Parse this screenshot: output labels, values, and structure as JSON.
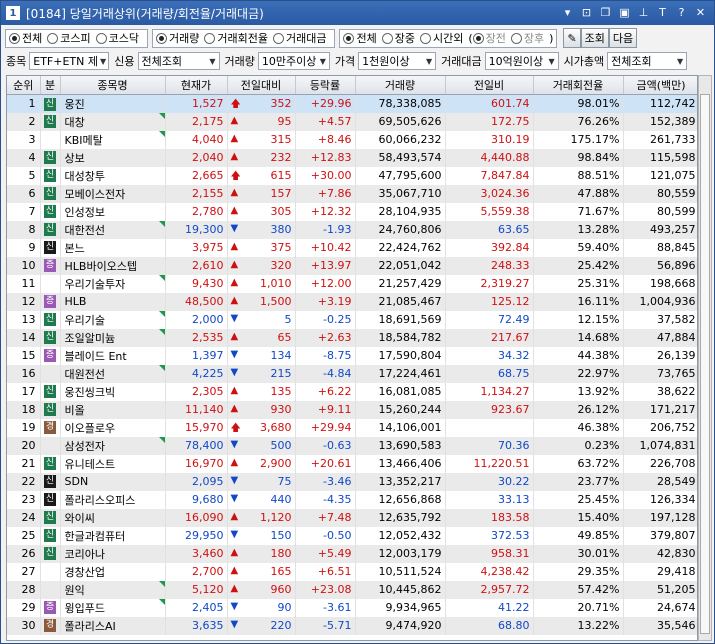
{
  "window": {
    "number": "1",
    "title": "[0184] 당일거래상위(거래량/회전율/거래대금)"
  },
  "toolbar_icons": [
    "grid-icon",
    "m-icon",
    "window-icon",
    "copy-icon",
    "pin-icon",
    "font-icon",
    "help-icon",
    "close-icon"
  ],
  "filters": {
    "market": [
      {
        "label": "전체",
        "on": true
      },
      {
        "label": "코스피",
        "on": false
      },
      {
        "label": "코스닥",
        "on": false
      }
    ],
    "sort": [
      {
        "label": "거래량",
        "on": true
      },
      {
        "label": "거래회전율",
        "on": false
      },
      {
        "label": "거래대금",
        "on": false
      }
    ],
    "session": [
      {
        "label": "전체",
        "on": true
      },
      {
        "label": "장중",
        "on": false
      },
      {
        "label": "시간외",
        "on": false
      }
    ],
    "after": [
      {
        "label": "장전",
        "on": true
      },
      {
        "label": "장후",
        "on": false
      }
    ],
    "query_label": "조회",
    "next_label": "다음"
  },
  "conditions": {
    "item_label": "종목",
    "item_value": "ETF+ETN 제",
    "credit_label": "신용",
    "credit_value": "전체조회",
    "volume_label": "거래량",
    "volume_value": "10만주이상",
    "price_label": "가격",
    "price_value": "1천원이상",
    "amount_label": "거래대금",
    "amount_value": "10억원이상",
    "cap_label": "시가총액",
    "cap_value": "전체조회"
  },
  "columns": [
    "순위",
    "분",
    "종목명",
    "현재가",
    "전일대비",
    "등락률",
    "거래량",
    "전일비",
    "거래회전율",
    "금액(백만)"
  ],
  "rows": [
    {
      "rank": "1",
      "badge": "신",
      "bc": "green",
      "name": "웅진",
      "tri": false,
      "price": "1,527",
      "dir": "limitup",
      "chg": "352",
      "rate": "+29.96",
      "vol": "78,338,085",
      "prev": "601.74",
      "turn": "98.01%",
      "amt": "112,742"
    },
    {
      "rank": "2",
      "badge": "신",
      "bc": "green",
      "name": "대창",
      "tri": true,
      "price": "2,175",
      "dir": "up",
      "chg": "95",
      "rate": "+4.57",
      "vol": "69,505,626",
      "prev": "172.75",
      "turn": "76.26%",
      "amt": "152,389"
    },
    {
      "rank": "3",
      "badge": "",
      "bc": "",
      "name": "KBI메탈",
      "tri": true,
      "price": "4,040",
      "dir": "up",
      "chg": "315",
      "rate": "+8.46",
      "vol": "60,066,232",
      "prev": "310.19",
      "turn": "175.17%",
      "amt": "261,733"
    },
    {
      "rank": "4",
      "badge": "신",
      "bc": "green",
      "name": "상보",
      "tri": false,
      "price": "2,040",
      "dir": "up",
      "chg": "232",
      "rate": "+12.83",
      "vol": "58,493,574",
      "prev": "4,440.88",
      "turn": "98.84%",
      "amt": "115,598"
    },
    {
      "rank": "5",
      "badge": "신",
      "bc": "green",
      "name": "대성창투",
      "tri": false,
      "price": "2,665",
      "dir": "limitup",
      "chg": "615",
      "rate": "+30.00",
      "vol": "47,795,600",
      "prev": "7,847.84",
      "turn": "88.51%",
      "amt": "121,075"
    },
    {
      "rank": "6",
      "badge": "신",
      "bc": "green",
      "name": "모베이스전자",
      "tri": false,
      "price": "2,155",
      "dir": "up",
      "chg": "157",
      "rate": "+7.86",
      "vol": "35,067,710",
      "prev": "3,024.36",
      "turn": "47.88%",
      "amt": "80,559"
    },
    {
      "rank": "7",
      "badge": "신",
      "bc": "green",
      "name": "인성정보",
      "tri": false,
      "price": "2,780",
      "dir": "up",
      "chg": "305",
      "rate": "+12.32",
      "vol": "28,104,935",
      "prev": "5,559.38",
      "turn": "71.67%",
      "amt": "80,599"
    },
    {
      "rank": "8",
      "badge": "신",
      "bc": "green",
      "name": "대한전선",
      "tri": true,
      "price": "19,300",
      "dir": "down",
      "chg": "380",
      "rate": "-1.93",
      "vol": "24,760,806",
      "prev": "63.65",
      "turn": "13.28%",
      "amt": "493,257"
    },
    {
      "rank": "9",
      "badge": "신",
      "bc": "dark",
      "name": "본느",
      "tri": false,
      "price": "3,975",
      "dir": "up",
      "chg": "375",
      "rate": "+10.42",
      "vol": "22,424,762",
      "prev": "392.84",
      "turn": "59.40%",
      "amt": "88,845"
    },
    {
      "rank": "10",
      "badge": "증",
      "bc": "purple",
      "name": "HLB바이오스텝",
      "tri": false,
      "price": "2,610",
      "dir": "up",
      "chg": "320",
      "rate": "+13.97",
      "vol": "22,051,042",
      "prev": "248.33",
      "turn": "25.42%",
      "amt": "56,896"
    },
    {
      "rank": "11",
      "badge": "",
      "bc": "",
      "name": "우리기술투자",
      "tri": true,
      "price": "9,430",
      "dir": "up",
      "chg": "1,010",
      "rate": "+12.00",
      "vol": "21,257,429",
      "prev": "2,319.27",
      "turn": "25.31%",
      "amt": "198,668"
    },
    {
      "rank": "12",
      "badge": "증",
      "bc": "purple",
      "name": "HLB",
      "tri": false,
      "price": "48,500",
      "dir": "up",
      "chg": "1,500",
      "rate": "+3.19",
      "vol": "21,085,467",
      "prev": "125.12",
      "turn": "16.11%",
      "amt": "1,004,936"
    },
    {
      "rank": "13",
      "badge": "신",
      "bc": "green",
      "name": "우리기술",
      "tri": true,
      "price": "2,000",
      "dir": "down",
      "chg": "5",
      "rate": "-0.25",
      "vol": "18,691,569",
      "prev": "72.49",
      "turn": "12.15%",
      "amt": "37,582"
    },
    {
      "rank": "14",
      "badge": "신",
      "bc": "green",
      "name": "조일알미늄",
      "tri": true,
      "price": "2,535",
      "dir": "up",
      "chg": "65",
      "rate": "+2.63",
      "vol": "18,584,782",
      "prev": "217.67",
      "turn": "14.68%",
      "amt": "47,884"
    },
    {
      "rank": "15",
      "badge": "증",
      "bc": "purple",
      "name": "블레이드 Ent",
      "tri": false,
      "price": "1,397",
      "dir": "down",
      "chg": "134",
      "rate": "-8.75",
      "vol": "17,590,804",
      "prev": "34.32",
      "turn": "44.38%",
      "amt": "26,139"
    },
    {
      "rank": "16",
      "badge": "",
      "bc": "",
      "name": "대원전선",
      "tri": true,
      "price": "4,225",
      "dir": "down",
      "chg": "215",
      "rate": "-4.84",
      "vol": "17,224,461",
      "prev": "68.75",
      "turn": "22.97%",
      "amt": "73,765"
    },
    {
      "rank": "17",
      "badge": "신",
      "bc": "green",
      "name": "웅진씽크빅",
      "tri": false,
      "price": "2,305",
      "dir": "up",
      "chg": "135",
      "rate": "+6.22",
      "vol": "16,081,085",
      "prev": "1,134.27",
      "turn": "13.92%",
      "amt": "38,622"
    },
    {
      "rank": "18",
      "badge": "신",
      "bc": "green",
      "name": "비올",
      "tri": false,
      "price": "11,140",
      "dir": "up",
      "chg": "930",
      "rate": "+9.11",
      "vol": "15,260,244",
      "prev": "923.67",
      "turn": "26.12%",
      "amt": "171,217"
    },
    {
      "rank": "19",
      "badge": "경",
      "bc": "brown",
      "name": "이오플로우",
      "tri": false,
      "price": "15,970",
      "dir": "limitup",
      "chg": "3,680",
      "rate": "+29.94",
      "vol": "14,106,001",
      "prev": "",
      "turn": "46.38%",
      "amt": "206,752"
    },
    {
      "rank": "20",
      "badge": "",
      "bc": "",
      "name": "삼성전자",
      "tri": true,
      "price": "78,400",
      "dir": "down",
      "chg": "500",
      "rate": "-0.63",
      "vol": "13,690,583",
      "prev": "70.36",
      "turn": "0.23%",
      "amt": "1,074,831"
    },
    {
      "rank": "21",
      "badge": "신",
      "bc": "green",
      "name": "유니테스트",
      "tri": false,
      "price": "16,970",
      "dir": "up",
      "chg": "2,900",
      "rate": "+20.61",
      "vol": "13,466,406",
      "prev": "11,220.51",
      "turn": "63.72%",
      "amt": "226,708"
    },
    {
      "rank": "22",
      "badge": "신",
      "bc": "dark",
      "name": "SDN",
      "tri": false,
      "price": "2,095",
      "dir": "down",
      "chg": "75",
      "rate": "-3.46",
      "vol": "13,352,217",
      "prev": "30.22",
      "turn": "23.77%",
      "amt": "28,549"
    },
    {
      "rank": "23",
      "badge": "신",
      "bc": "dark",
      "name": "폴라리스오피스",
      "tri": false,
      "price": "9,680",
      "dir": "down",
      "chg": "440",
      "rate": "-4.35",
      "vol": "12,656,868",
      "prev": "33.13",
      "turn": "25.45%",
      "amt": "126,334"
    },
    {
      "rank": "24",
      "badge": "신",
      "bc": "green",
      "name": "와이씨",
      "tri": false,
      "price": "16,090",
      "dir": "up",
      "chg": "1,120",
      "rate": "+7.48",
      "vol": "12,635,792",
      "prev": "183.58",
      "turn": "15.40%",
      "amt": "197,128"
    },
    {
      "rank": "25",
      "badge": "신",
      "bc": "green",
      "name": "한글과컴퓨터",
      "tri": false,
      "price": "29,950",
      "dir": "down",
      "chg": "150",
      "rate": "-0.50",
      "vol": "12,052,432",
      "prev": "372.53",
      "turn": "49.85%",
      "amt": "379,807"
    },
    {
      "rank": "26",
      "badge": "신",
      "bc": "green",
      "name": "코리아나",
      "tri": false,
      "price": "3,460",
      "dir": "up",
      "chg": "180",
      "rate": "+5.49",
      "vol": "12,003,179",
      "prev": "958.31",
      "turn": "30.01%",
      "amt": "42,830"
    },
    {
      "rank": "27",
      "badge": "",
      "bc": "",
      "name": "경창산업",
      "tri": false,
      "price": "2,700",
      "dir": "up",
      "chg": "165",
      "rate": "+6.51",
      "vol": "10,511,524",
      "prev": "4,238.42",
      "turn": "29.35%",
      "amt": "29,418"
    },
    {
      "rank": "28",
      "badge": "",
      "bc": "",
      "name": "원익",
      "tri": true,
      "price": "5,120",
      "dir": "up",
      "chg": "960",
      "rate": "+23.08",
      "vol": "10,445,862",
      "prev": "2,957.72",
      "turn": "57.42%",
      "amt": "51,205"
    },
    {
      "rank": "29",
      "badge": "증",
      "bc": "purple",
      "name": "윙입푸드",
      "tri": true,
      "price": "2,405",
      "dir": "down",
      "chg": "90",
      "rate": "-3.61",
      "vol": "9,934,965",
      "prev": "41.22",
      "turn": "20.71%",
      "amt": "24,674"
    },
    {
      "rank": "30",
      "badge": "경",
      "bc": "brown",
      "name": "폴라리스AI",
      "tri": false,
      "price": "3,635",
      "dir": "down",
      "chg": "220",
      "rate": "-5.71",
      "vol": "9,474,920",
      "prev": "68.80",
      "turn": "13.22%",
      "amt": "35,546"
    }
  ],
  "colors": {
    "up": "#d01010",
    "down": "#1048c8",
    "limit": "#d01010",
    "selected": "#cfe3f7"
  }
}
